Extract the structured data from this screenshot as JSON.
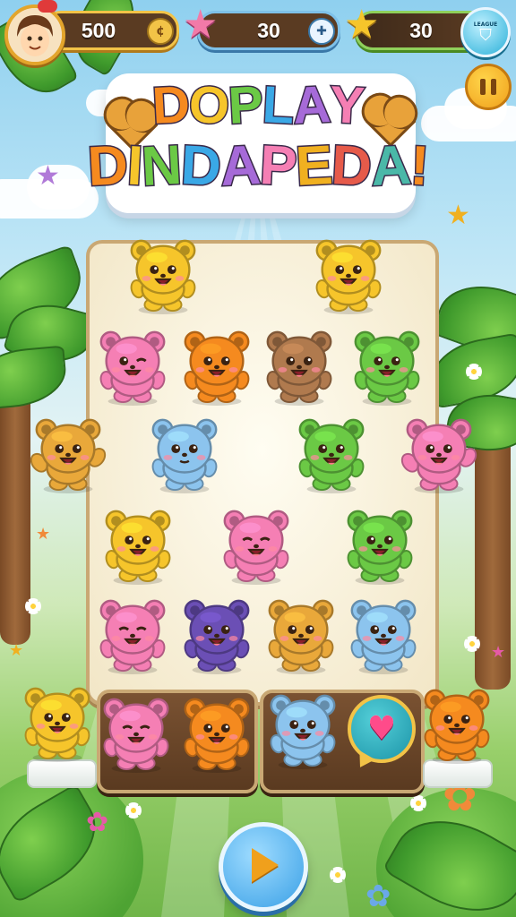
{
  "hud": {
    "coins": "500",
    "stars_pink": "30",
    "stars_gold": "30",
    "badge_text": "LEAGUE"
  },
  "title": {
    "line1": "DOPLAY",
    "line2": "DINDAPEDA!"
  },
  "colors": {
    "yellow": "#f6c52b",
    "orange": "#f58a1f",
    "brown": "#b07a4e",
    "green": "#6bc945",
    "pink": "#f57fb4",
    "blue": "#8cc4ee",
    "purple": "#6b4fb5",
    "gold": "#e9a83a"
  },
  "board": [
    {
      "color": "yellow",
      "expression": "smile"
    },
    {
      "color": "yellow",
      "expression": "happy"
    },
    {
      "color": "pink",
      "expression": "wink"
    },
    {
      "color": "orange",
      "expression": "happy"
    },
    {
      "color": "brown",
      "expression": "happy"
    },
    {
      "color": "green",
      "expression": "happy"
    },
    {
      "color": "gold",
      "expression": "cheer"
    },
    {
      "color": "blue",
      "expression": "calm"
    },
    {
      "color": "green",
      "expression": "happy"
    },
    {
      "color": "pink",
      "expression": "cheer"
    },
    {
      "color": "yellow",
      "expression": "happy"
    },
    {
      "color": "pink",
      "expression": "closed"
    },
    {
      "color": "green",
      "expression": "happy"
    },
    {
      "color": "pink",
      "expression": "closed"
    },
    {
      "color": "purple",
      "expression": "happy"
    },
    {
      "color": "gold",
      "expression": "happy"
    },
    {
      "color": "blue",
      "expression": "happy"
    }
  ],
  "tray": [
    {
      "color": "yellow",
      "expression": "happy"
    },
    {
      "color": "pink",
      "expression": "closed"
    },
    {
      "color": "orange",
      "expression": "happy"
    },
    {
      "color": "blue",
      "expression": "happy"
    },
    {
      "color": "orange",
      "expression": "happy"
    }
  ],
  "icons": {
    "coin": "coin-icon",
    "pink_star": "star-icon",
    "gold_star": "star-icon",
    "league": "badge-icon",
    "pause": "pause-icon",
    "bubble": "heart-icon",
    "play": "play-icon"
  }
}
